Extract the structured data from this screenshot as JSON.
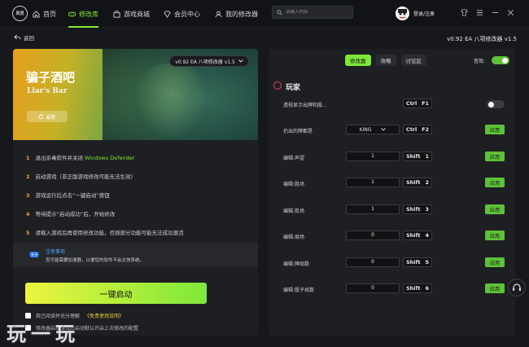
{
  "app": {
    "logo_text": "风灵",
    "nav": [
      {
        "label": "首页",
        "icon": "home-icon"
      },
      {
        "label": "修改库",
        "icon": "gamepad-icon"
      },
      {
        "label": "游戏商城",
        "icon": "store-icon"
      },
      {
        "label": "会员中心",
        "icon": "vip-icon"
      },
      {
        "label": "我的修改器",
        "icon": "user-tool-icon"
      }
    ],
    "active_nav": "修改库",
    "search_placeholder": "请输入内容",
    "login_label": "登录/注册"
  },
  "subheader": {
    "back_label": "返回",
    "version": "v0.92 EA 八项修改器 v1.5"
  },
  "game": {
    "title_cn": "骗子酒吧",
    "title_en": "Liar's Bar",
    "refresh_label": "最新",
    "version_select": "v0.92 EA 八项修改器 v1.5"
  },
  "steps": [
    {
      "num": "1",
      "text": "退出杀毒软件并关闭 ",
      "highlight": "Windows Defender"
    },
    {
      "num": "2",
      "text": "启动游戏（非正版游戏修改可能无法生效）",
      "highlight": ""
    },
    {
      "num": "3",
      "text": "游戏运行后点击“一键启动”按钮",
      "highlight": ""
    },
    {
      "num": "4",
      "text": "等待提示“启动成功”后，开始修改",
      "highlight": ""
    },
    {
      "num": "5",
      "text": "请载入游戏后再使用修改功能，否则部分功能可能无法成功激活",
      "highlight": ""
    }
  ],
  "notice": {
    "title": "注意事项",
    "text": "您可能需要加速器，以便您的软件不会太快系统。"
  },
  "launch": {
    "label": "一键启动",
    "agree_text": "我已阅读并充分理解",
    "agree_link": "《免责使用说明》",
    "auto_text": "修改器启动游戏后启动默认开启上次修改的配置"
  },
  "panel": {
    "tabs": [
      "修改器",
      "攻略",
      "讨论区"
    ],
    "active_tab": "修改器",
    "sound_label": "音效:",
    "sound_on": true,
    "section": "玩家",
    "apply_label": "应用",
    "rows": [
      {
        "label": "透视显示出牌和股...",
        "control": "toggle",
        "value": "",
        "mod": "Ctrl",
        "key": "F1",
        "on": false
      },
      {
        "label": "扔出的牌都是",
        "control": "dropdown",
        "value": "KING",
        "mod": "Ctrl",
        "key": "F2"
      },
      {
        "label": "编辑:声望",
        "control": "input",
        "value": "1",
        "mod": "Shift",
        "key": "1"
      },
      {
        "label": "编辑:胜场",
        "control": "input",
        "value": "1",
        "mod": "Shift",
        "key": "2"
      },
      {
        "label": "编辑:败场",
        "control": "input",
        "value": "1",
        "mod": "Shift",
        "key": "3"
      },
      {
        "label": "编辑:周场",
        "control": "input",
        "value": "0",
        "mod": "Shift",
        "key": "4"
      },
      {
        "label": "编辑:牌局数",
        "control": "input",
        "value": "0",
        "mod": "Shift",
        "key": "5"
      },
      {
        "label": "编辑:骰子局数",
        "control": "input",
        "value": "0",
        "mod": "Shift",
        "key": "6"
      }
    ]
  },
  "watermark": "玩一玩"
}
